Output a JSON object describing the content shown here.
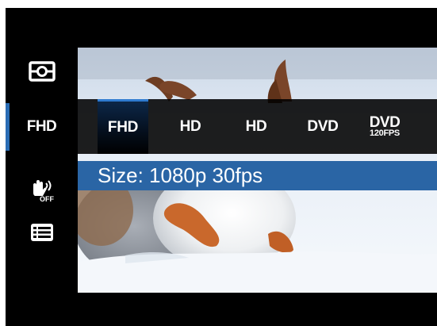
{
  "sidebar": {
    "items": [
      {
        "icon": "metering-icon"
      },
      {
        "label": "FHD",
        "selected": true
      },
      {
        "icon": "stabilization-off-icon",
        "icon_text": "OFF"
      },
      {
        "icon": "list-menu-icon"
      }
    ]
  },
  "resolution_options": [
    {
      "label": "FHD",
      "selected": true
    },
    {
      "label": "HD"
    },
    {
      "label": "HD"
    },
    {
      "label": "DVD"
    },
    {
      "label": "DVD",
      "sub": "120FPS"
    }
  ],
  "info": {
    "text": "Size: 1080p 30fps"
  },
  "colors": {
    "accent": "#2a65a5",
    "selection_edge": "#2f7bd0"
  }
}
